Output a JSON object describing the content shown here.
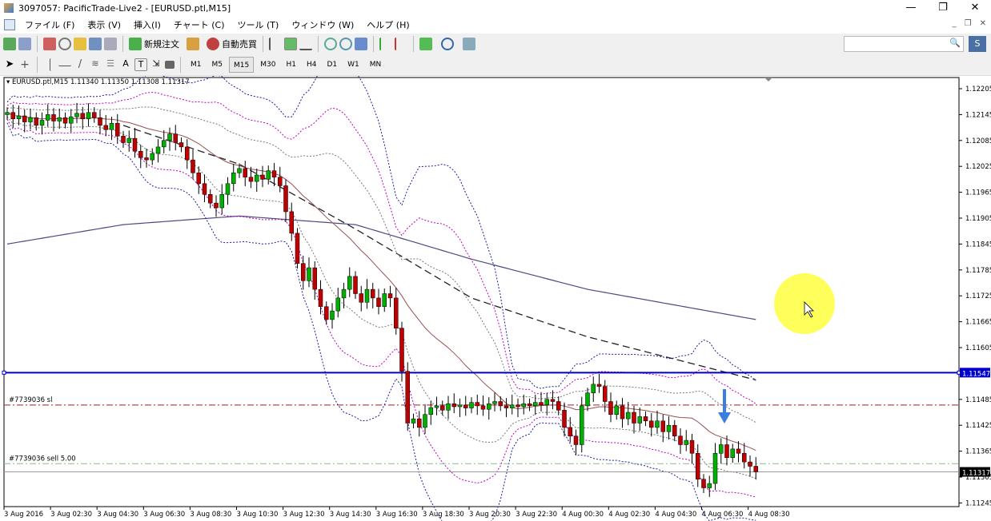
{
  "window": {
    "title": "3097057: PacificTrade-Live2 - [EURUSD.ptl,M15]",
    "min": "—",
    "max": "❐",
    "close": "✕"
  },
  "menu": [
    "ファイル (F)",
    "表示 (V)",
    "挿入(I)",
    "チャート (C)",
    "ツール (T)",
    "ウィンドウ (W)",
    "ヘルプ (H)"
  ],
  "mdi": [
    "_",
    "❐",
    "✕"
  ],
  "toolbar": {
    "new_order": "新規注文",
    "auto_trade": "自動売買",
    "search_placeholder": "",
    "search_icon": "🔍",
    "signal_label": "S"
  },
  "tools": [
    "cursor",
    "crosshair",
    "vertical-line",
    "horizontal-line",
    "trend-line",
    "fibo",
    "grid",
    "text",
    "text-label",
    "arrows",
    "color"
  ],
  "tool_text": {
    "text": "A",
    "label": "T"
  },
  "timeframes": [
    "M1",
    "M5",
    "M15",
    "M30",
    "H1",
    "H4",
    "D1",
    "W1",
    "MN"
  ],
  "active_timeframe": "M15",
  "chart": {
    "symbol_info": "EURUSD.ptl,M15  1.11340 1.11350 1.11308 1.11317",
    "sl_label": "#7739036 sl",
    "sell_label": "#7739036 sell 5.00",
    "blue_line_label": "1.11547",
    "bid_label": "1.11317"
  },
  "chart_data": {
    "type": "candlestick",
    "ylim": [
      1.11245,
      1.12225
    ],
    "yticks": [
      "1.12205",
      "1.12145",
      "1.12085",
      "1.12025",
      "1.11965",
      "1.11905",
      "1.11845",
      "1.11785",
      "1.11725",
      "1.11665",
      "1.11605",
      "1.11485",
      "1.11425",
      "1.11365",
      "1.11305",
      "1.11245"
    ],
    "xticks": [
      "3 Aug 2016",
      "3 Aug 02:30",
      "3 Aug 04:30",
      "3 Aug 06:30",
      "3 Aug 08:30",
      "3 Aug 10:30",
      "3 Aug 12:30",
      "3 Aug 14:30",
      "3 Aug 16:30",
      "3 Aug 18:30",
      "3 Aug 20:30",
      "3 Aug 22:30",
      "4 Aug 00:30",
      "4 Aug 02:30",
      "4 Aug 04:30",
      "4 Aug 06:30",
      "4 Aug 08:30"
    ],
    "first_open": 1.12145,
    "closes": [
      1.1215,
      1.12135,
      1.12142,
      1.12128,
      1.12138,
      1.1212,
      1.12132,
      1.12145,
      1.1213,
      1.12138,
      1.12125,
      1.1214,
      1.12148,
      1.12135,
      1.1215,
      1.12138,
      1.1212,
      1.1211,
      1.12125,
      1.12095,
      1.1208,
      1.1209,
      1.1206,
      1.12045,
      1.1204,
      1.12055,
      1.1207,
      1.12085,
      1.121,
      1.1208,
      1.1207,
      1.1204,
      1.1201,
      1.11985,
      1.1196,
      1.1194,
      1.11929,
      1.1196,
      1.11985,
      1.1201,
      1.1202,
      1.12,
      1.1199,
      1.12005,
      1.11995,
      1.12015,
      1.12,
      1.1198,
      1.1192,
      1.1187,
      1.118,
      1.1176,
      1.1179,
      1.1174,
      1.117,
      1.1167,
      1.1169,
      1.1172,
      1.1174,
      1.1177,
      1.1173,
      1.1171,
      1.1174,
      1.1172,
      1.117,
      1.1173,
      1.1172,
      1.1165,
      1.1155,
      1.1143,
      1.1144,
      1.1142,
      1.1145,
      1.11466,
      1.1147,
      1.1146,
      1.11475,
      1.11468,
      1.11472,
      1.11465,
      1.11478,
      1.1147,
      1.11462,
      1.11475,
      1.1148,
      1.1147,
      1.11465,
      1.11472,
      1.11468,
      1.11475,
      1.1147,
      1.11478,
      1.11472,
      1.11485,
      1.1148,
      1.1146,
      1.1142,
      1.114,
      1.1138,
      1.1147,
      1.115,
      1.1152,
      1.11515,
      1.1148,
      1.1145,
      1.1147,
      1.1144,
      1.11455,
      1.1143,
      1.11445,
      1.11435,
      1.1142,
      1.11435,
      1.1141,
      1.11425,
      1.114,
      1.1138,
      1.1139,
      1.1136,
      1.113,
      1.1128,
      1.1129,
      1.1136,
      1.1138,
      1.1135,
      1.1137,
      1.1136,
      1.1134,
      1.1133,
      1.11317
    ],
    "ma_long": {
      "bars": [
        0,
        20,
        40,
        60,
        80,
        100,
        129
      ],
      "values": [
        1.11845,
        1.1189,
        1.1191,
        1.1189,
        1.1181,
        1.1174,
        1.1167
      ]
    },
    "ma_dashed": {
      "bars": [
        20,
        40,
        60,
        80,
        100,
        129
      ],
      "values": [
        1.1212,
        1.1203,
        1.1188,
        1.1172,
        1.1163,
        1.1153
      ]
    },
    "levels": {
      "blue_line": 1.11547,
      "stop_loss": 1.11472,
      "sell_entry": 1.11336,
      "bid": 1.11317
    },
    "colors": {
      "bull": "#00b000",
      "bear": "#c00000",
      "blue_line": "#0000cc",
      "sl": "#a02020",
      "sell": "#88bb88",
      "ma_long": "#4a4a80",
      "bb_outer": "#1a1aa0",
      "bb_inner": "#c000c0",
      "arrow": "#3a7fe0",
      "highlight": "#ffff40"
    }
  }
}
